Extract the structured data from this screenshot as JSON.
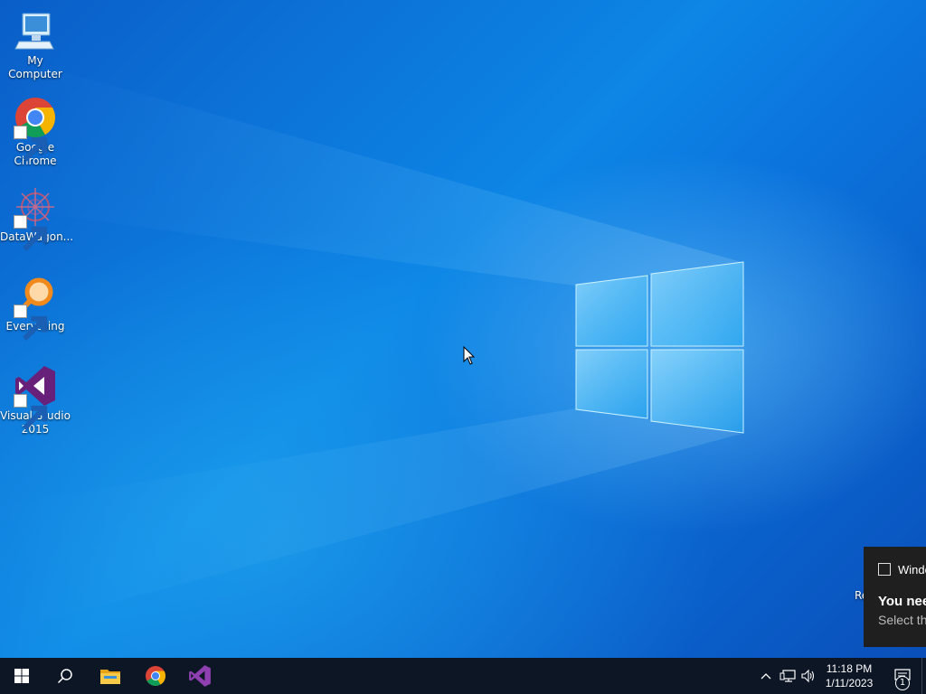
{
  "desktop": {
    "icons": [
      {
        "label": "My Computer",
        "icon": "computer-icon"
      },
      {
        "label": "Google\nChrome",
        "icon": "chrome-icon"
      },
      {
        "label": "DataWagon...",
        "icon": "datawagon-icon"
      },
      {
        "label": "Everything",
        "icon": "everything-search-icon"
      },
      {
        "label": "Visual Studio\n2015",
        "icon": "visual-studio-icon"
      }
    ],
    "edge_fragment": "Re"
  },
  "toast": {
    "app_name": "Windo",
    "title": "You nee",
    "body": "Select th"
  },
  "taskbar": {
    "start_icon": "windows-logo-icon",
    "search_icon": "search-icon",
    "pinned": [
      {
        "name": "file-explorer",
        "icon": "folder-icon"
      },
      {
        "name": "chrome",
        "icon": "chrome-icon"
      },
      {
        "name": "visual-studio",
        "icon": "visual-studio-icon"
      }
    ],
    "tray": {
      "chevron_icon": "chevron-up-icon",
      "network_icon": "network-icon",
      "volume_icon": "volume-icon",
      "time": "11:18 PM",
      "date": "1/11/2023",
      "notification_count": "1"
    }
  },
  "colors": {
    "taskbar_bg": "#0c1624",
    "toast_bg": "#1f1f1f",
    "wallpaper_accent": "#0a6fd8"
  }
}
